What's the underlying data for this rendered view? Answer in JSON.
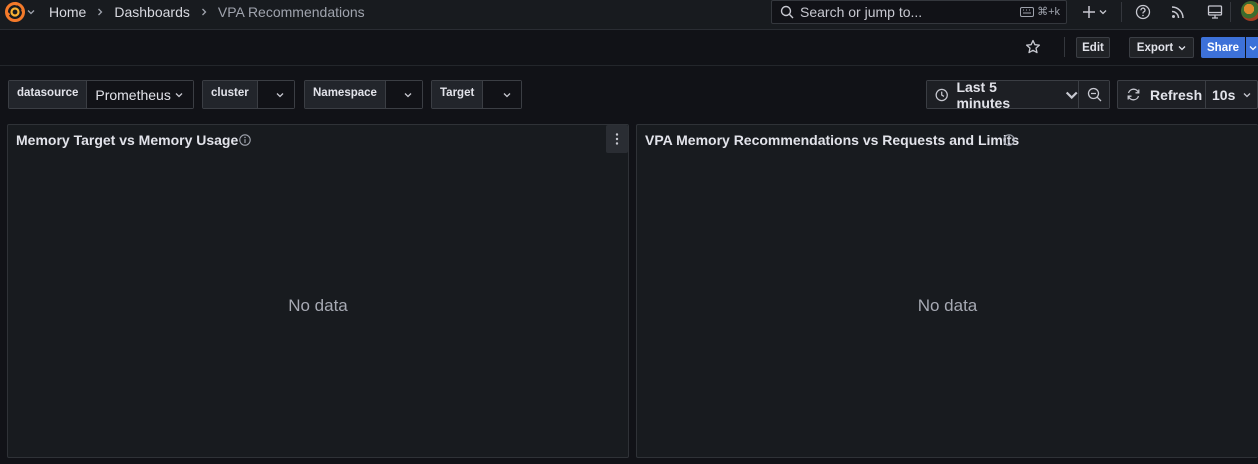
{
  "breadcrumbs": [
    "Home",
    "Dashboards",
    "VPA Recommendations"
  ],
  "search": {
    "placeholder": "Search or jump to...",
    "shortcut": "⌘+k"
  },
  "toolbar": {
    "edit_label": "Edit",
    "export_label": "Export",
    "share_label": "Share"
  },
  "variables": [
    {
      "label": "datasource",
      "value": "Prometheus"
    },
    {
      "label": "cluster",
      "value": ""
    },
    {
      "label": "Namespace",
      "value": ""
    },
    {
      "label": "Target",
      "value": ""
    }
  ],
  "time_range": {
    "label": "Last 5 minutes"
  },
  "refresh": {
    "label": "Refresh",
    "interval": "10s"
  },
  "panels": [
    {
      "title": "Memory Target vs Memory Usage",
      "message": "No data"
    },
    {
      "title": "VPA Memory Recommendations vs Requests and Limits",
      "message": "No data"
    }
  ],
  "colors": {
    "primary": "#3d71d9",
    "background": "#111217",
    "panel": "#181b1f"
  },
  "icons": [
    "grafana-logo",
    "chevron-down-icon",
    "chevron-right-icon",
    "search-icon",
    "keyboard-icon",
    "plus-icon",
    "help-icon",
    "rss-icon",
    "monitor-icon",
    "star-icon",
    "clock-icon",
    "zoom-out-icon",
    "refresh-icon",
    "info-icon",
    "kebab-menu-icon"
  ]
}
